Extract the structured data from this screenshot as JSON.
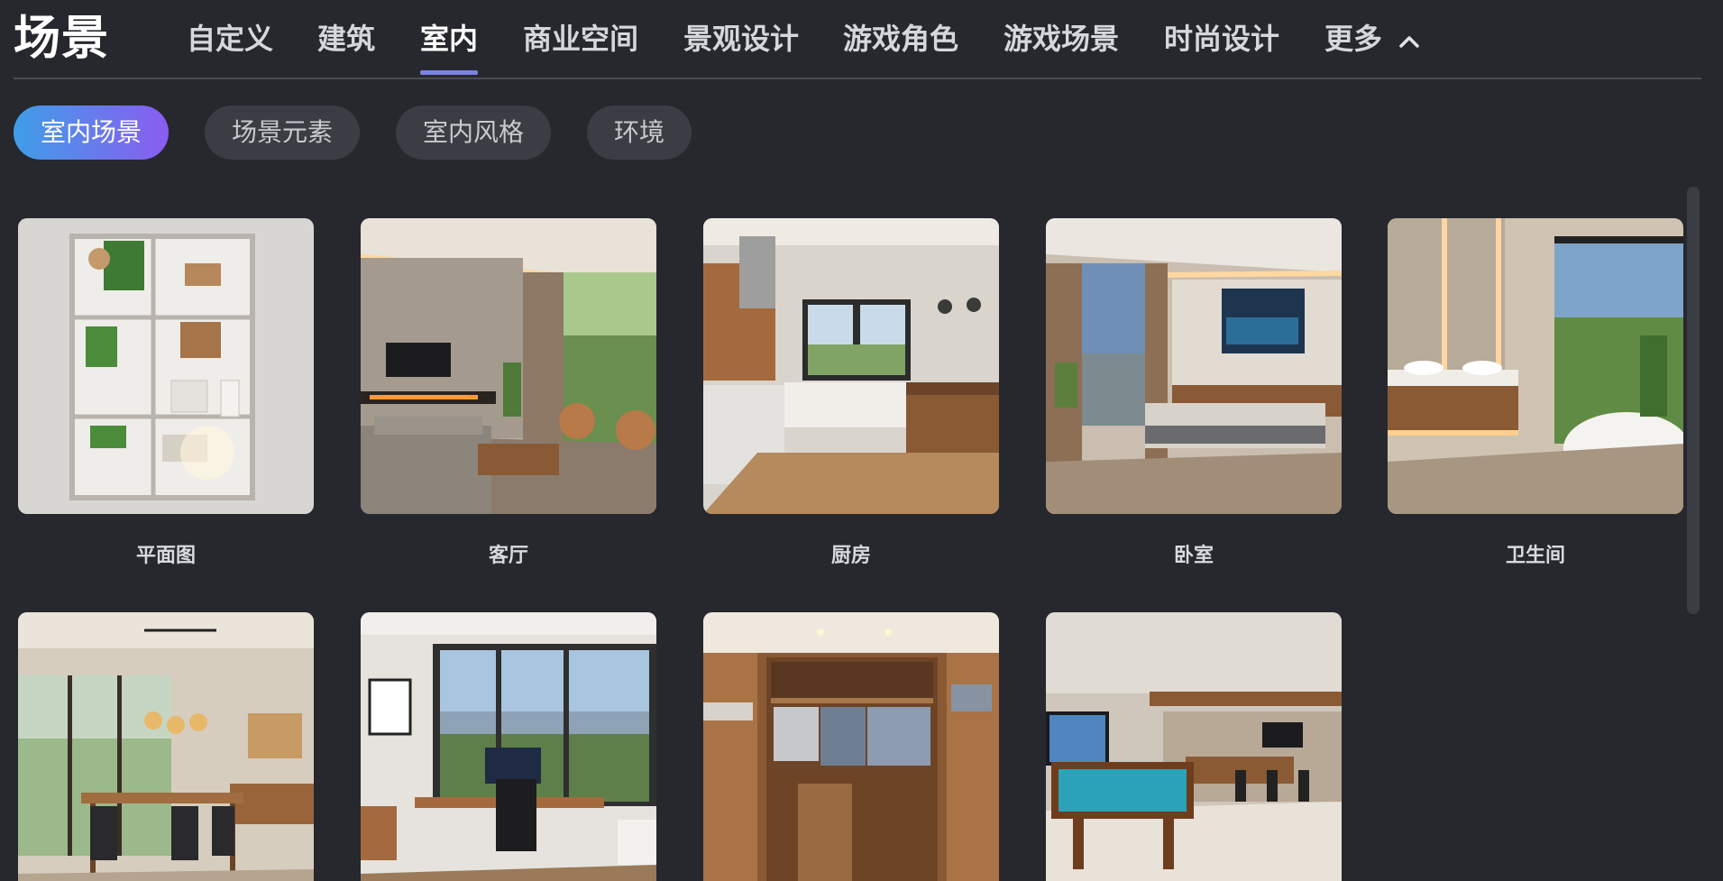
{
  "header": {
    "title": "场景",
    "tabs": [
      {
        "label": "自定义"
      },
      {
        "label": "建筑"
      },
      {
        "label": "室内"
      },
      {
        "label": "商业空间"
      },
      {
        "label": "景观设计"
      },
      {
        "label": "游戏角色"
      },
      {
        "label": "游戏场景"
      },
      {
        "label": "时尚设计"
      },
      {
        "label": "更多"
      }
    ],
    "active_tab": "室内",
    "more_icon": "chevron-up-icon"
  },
  "pills": [
    {
      "label": "室内场景"
    },
    {
      "label": "场景元素"
    },
    {
      "label": "室内风格"
    },
    {
      "label": "环境"
    }
  ],
  "active_pill": "室内场景",
  "cards": [
    {
      "label": "平面图"
    },
    {
      "label": "客厅"
    },
    {
      "label": "厨房"
    },
    {
      "label": "卧室"
    },
    {
      "label": "卫生间"
    },
    {
      "label": ""
    },
    {
      "label": ""
    },
    {
      "label": ""
    },
    {
      "label": ""
    }
  ],
  "colors": {
    "background": "#26282e",
    "accent_underline": "#7c83e6",
    "pill_gradient_start": "#3f9ee8",
    "pill_gradient_end": "#8a5cf0",
    "pill_inactive": "#3a3d44"
  }
}
